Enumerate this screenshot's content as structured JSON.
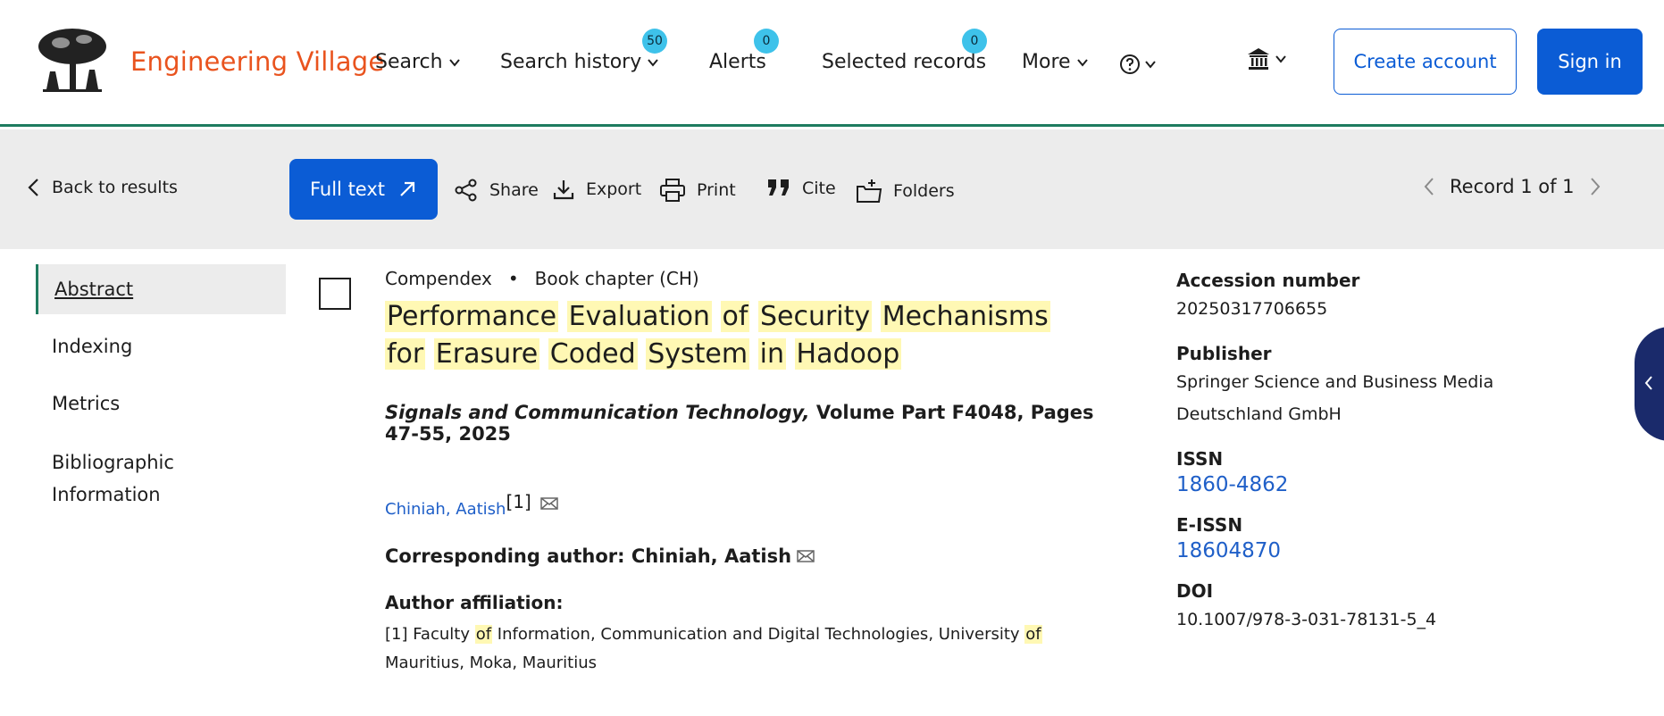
{
  "header": {
    "brand": "Engineering Village",
    "nav": {
      "search": "Search",
      "history": "Search history",
      "history_count": "50",
      "alerts": "Alerts",
      "alerts_count": "0",
      "selected": "Selected records",
      "selected_count": "0",
      "more": "More"
    },
    "create_account": "Create account",
    "sign_in": "Sign in"
  },
  "toolbar": {
    "back": "Back to results",
    "full_text": "Full text",
    "share": "Share",
    "export": "Export",
    "print": "Print",
    "cite": "Cite",
    "folders": "Folders",
    "record": "Record 1 of 1"
  },
  "sidebar": {
    "items": [
      {
        "label": "Abstract"
      },
      {
        "label": "Indexing"
      },
      {
        "label": "Metrics"
      },
      {
        "label": "Bibliographic Information"
      }
    ]
  },
  "record": {
    "database": "Compendex",
    "doc_type": "Book chapter (CH)",
    "title_words_line1": [
      "Performance",
      "Evaluation",
      "of",
      "Security",
      "Mechanisms"
    ],
    "title_words_line2": [
      "for",
      "Erasure",
      "Coded",
      "System",
      "in",
      "Hadoop"
    ],
    "source_title": "Signals and Communication Technology,",
    "source_rest": " Volume Part F4048, Pages 47-55, 2025",
    "author": "Chiniah, Aatish",
    "author_ref": "[1]",
    "corresponding": "Corresponding author: Chiniah, Aatish",
    "affiliation_label": "Author affiliation:",
    "aff_part1": "[1] Faculty ",
    "aff_of1": "of",
    "aff_part2": " Information, Communication and Digital Technologies, University ",
    "aff_of2": "of",
    "aff_part3": " Mauritius, Moka, Mauritius"
  },
  "details": {
    "accession_label": "Accession number",
    "accession": "20250317706655",
    "publisher_label": "Publisher",
    "publisher_line1": "Springer Science and Business Media",
    "publisher_line2": "Deutschland GmbH",
    "issn_label": "ISSN",
    "issn": "1860-4862",
    "eissn_label": "E-ISSN",
    "eissn": "18604870",
    "doi_label": "DOI",
    "doi": "10.1007/978-3-031-78131-5_4"
  },
  "colors": {
    "brand": "#e9531e",
    "primary": "#0b5cd5",
    "accent_green": "#1e7b5f",
    "badge": "#3ec2ea",
    "highlight": "#fff8b4",
    "link": "#1f5fc8"
  }
}
